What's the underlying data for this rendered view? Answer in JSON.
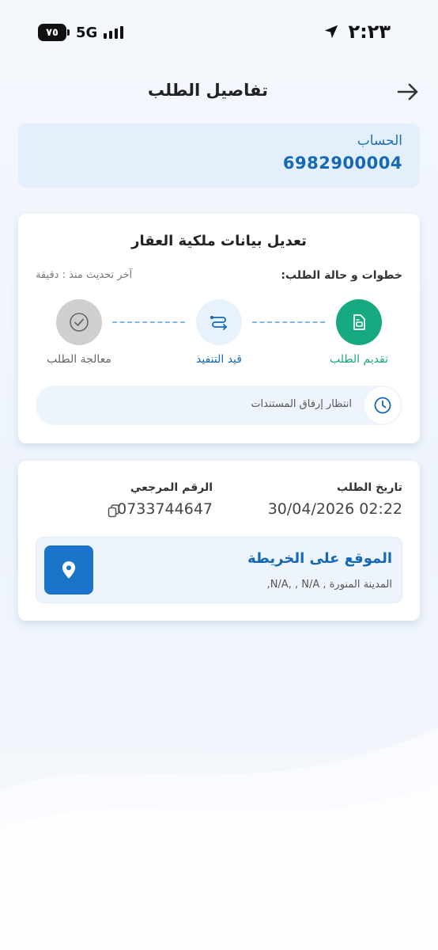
{
  "status_bar": {
    "battery": "٧٥",
    "network": "5G",
    "time": "٢:٢٣"
  },
  "header": {
    "title": "تفاصيل الطلب",
    "back_icon": "arrow-right-icon"
  },
  "account": {
    "label": "الحساب",
    "number": "6982900004"
  },
  "request": {
    "title": "تعديل بيانات ملكية العقار",
    "steps_label": "خطوات و حالة الطلب:",
    "last_update": "آخر تحديث منذ :  دقيقة",
    "steps": [
      {
        "label": "تقديم الطلب",
        "icon": "document-icon",
        "state": "done",
        "color": "#17a97f"
      },
      {
        "label": "قيد التنفيذ",
        "icon": "route-icon",
        "state": "current",
        "color": "#1568b5"
      },
      {
        "label": "معالجة الطلب",
        "icon": "check-circle-icon",
        "state": "pending",
        "color": "#666666"
      }
    ],
    "pending_text": "انتظار إرفاق المستندات"
  },
  "details": {
    "date_label": "تاريخ الطلب",
    "date_value": "30/04/2026 02:22",
    "reference_label": "الرقم المرجعي",
    "reference_value": "0733744647",
    "map_title": "الموقع على الخريطة",
    "map_address": "المدينة المنورة , N/A, , N/A,"
  },
  "colors": {
    "primary": "#1568b5",
    "success": "#17a97f",
    "account_bg": "#e3effb"
  }
}
